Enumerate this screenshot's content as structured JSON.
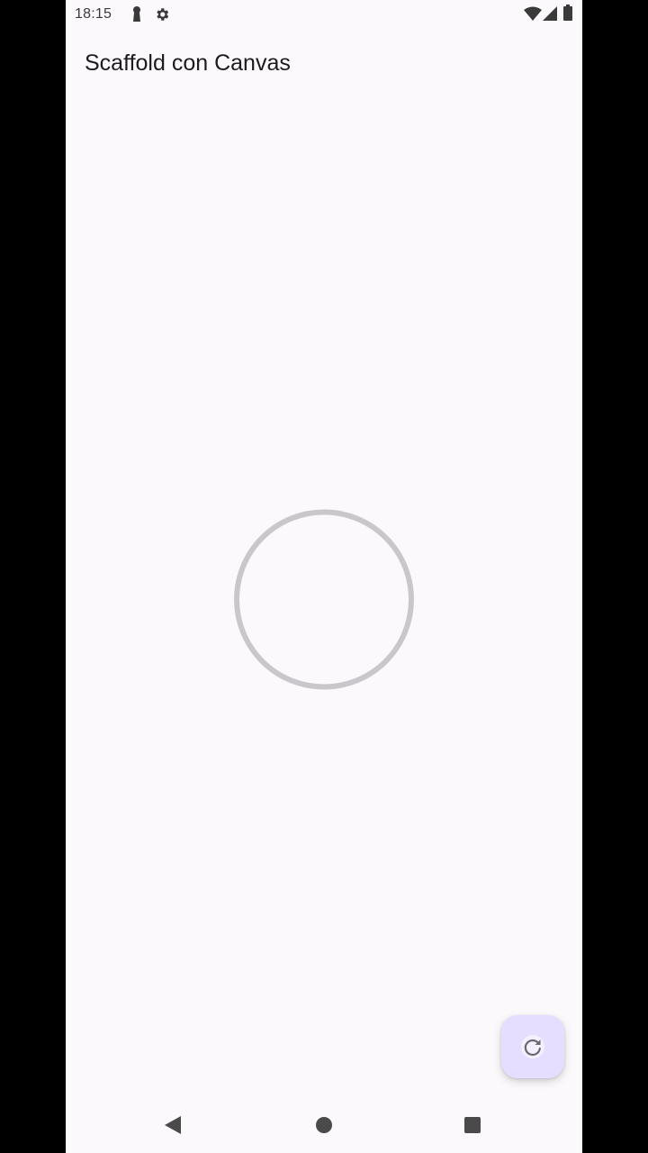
{
  "status_bar": {
    "time": "18:15",
    "icons": [
      "keyhole-icon",
      "settings-gear-icon",
      "wifi-icon",
      "cellular-signal-icon",
      "battery-icon"
    ]
  },
  "app_bar": {
    "title": "Scaffold con Canvas"
  },
  "canvas": {
    "shape": "circle-outline",
    "stroke_color": "#c9c7cc"
  },
  "fab": {
    "icon": "refresh-icon",
    "background_color": "#e6deff"
  },
  "nav_bar": {
    "buttons": [
      "back-triangle-icon",
      "home-circle-icon",
      "recents-square-icon"
    ]
  }
}
